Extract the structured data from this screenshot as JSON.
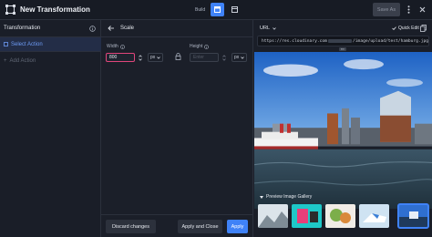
{
  "header": {
    "title": "New Transformation",
    "mode_label": "Build",
    "save_label": "Save As",
    "icons": [
      "transform-logo-icon",
      "build-mode-icon",
      "code-mode-icon",
      "more-vertical-icon",
      "close-icon"
    ]
  },
  "left_panel": {
    "title": "Transformation",
    "selected_action": "Select Action",
    "add_action": "Add Action"
  },
  "mid_panel": {
    "title": "Scale",
    "width_label": "Width",
    "width_value": "800",
    "width_unit": "px",
    "height_label": "Height",
    "height_placeholder": "Enter",
    "height_unit": "px",
    "buttons": {
      "discard": "Discard changes",
      "apply_close": "Apply and Close",
      "apply": "Apply"
    }
  },
  "right_panel": {
    "view_select": "URL",
    "quick_edit": "Quick Edit",
    "url_prefix": "https://res.cloudinary.com",
    "url_suffix": "/image/upload/test/hamburg.jpg",
    "gallery_label": "Preview Image Gallery"
  },
  "colors": {
    "accent": "#3f82f7",
    "focus": "#e0457b",
    "bg": "#1b1f29"
  }
}
